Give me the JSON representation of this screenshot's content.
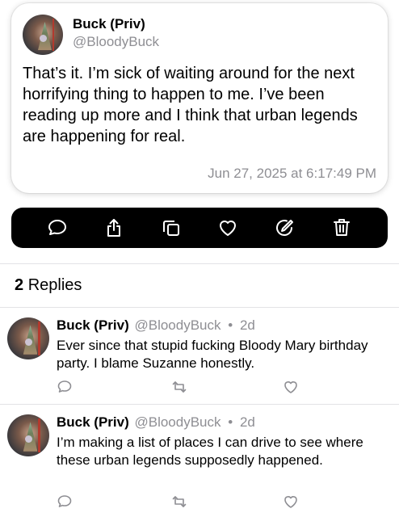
{
  "post": {
    "author_name": "Buck (Priv)",
    "author_handle": "@BloodyBuck",
    "text": "That’s it. I’m sick of waiting around for the next horrifying thing to happen to me. I’ve been reading up more and I think that urban legends are happening for real.",
    "timestamp": "Jun 27, 2025 at 6:17:49 PM"
  },
  "toolbar": {
    "icons": [
      "comment-icon",
      "share-icon",
      "copy-icon",
      "heart-icon",
      "edit-icon",
      "trash-icon"
    ]
  },
  "replies_header": {
    "count": "2",
    "label": "Replies"
  },
  "replies": [
    {
      "author_name": "Buck (Priv)",
      "author_handle": "@BloodyBuck",
      "separator": "•",
      "age": "2d",
      "text": "Ever since that stupid fucking Bloody Mary birthday party. I blame Suzanne honestly."
    },
    {
      "author_name": "Buck (Priv)",
      "author_handle": "@BloodyBuck",
      "separator": "•",
      "age": "2d",
      "text": "I’m making a list of places I can drive to see where these urban legends supposedly happened."
    }
  ],
  "colors": {
    "toolbar_bg": "#000000",
    "secondary_text": "#8e8e93",
    "separator": "#e3e3e6"
  }
}
